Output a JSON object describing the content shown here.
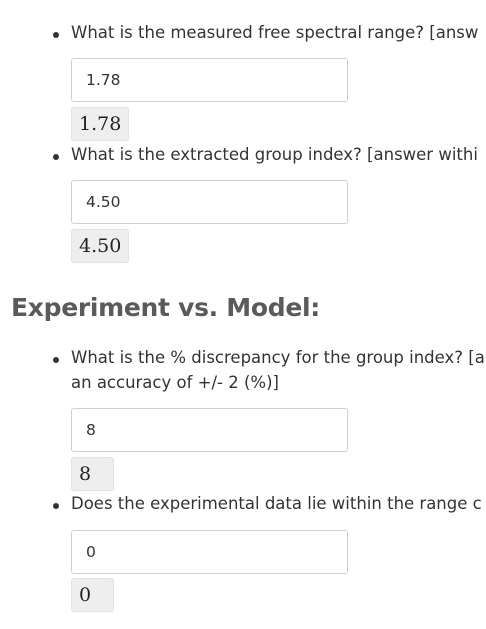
{
  "questions_top": [
    {
      "text": "What is the measured free spectral range? [answ",
      "input_value": "1.78",
      "preview": "1.78"
    },
    {
      "text": "What is the extracted group index? [answer withi",
      "input_value": "4.50",
      "preview": "4.50"
    }
  ],
  "section": {
    "heading": "Experiment vs. Model:"
  },
  "questions_bottom": [
    {
      "text": "What is the % discrepancy for the group index? [a an accuracy of +/- 2 (%)]",
      "input_value": "8",
      "preview": "8"
    },
    {
      "text": "Does the experimental data lie within the range c",
      "input_value": "0",
      "preview": "0"
    }
  ]
}
